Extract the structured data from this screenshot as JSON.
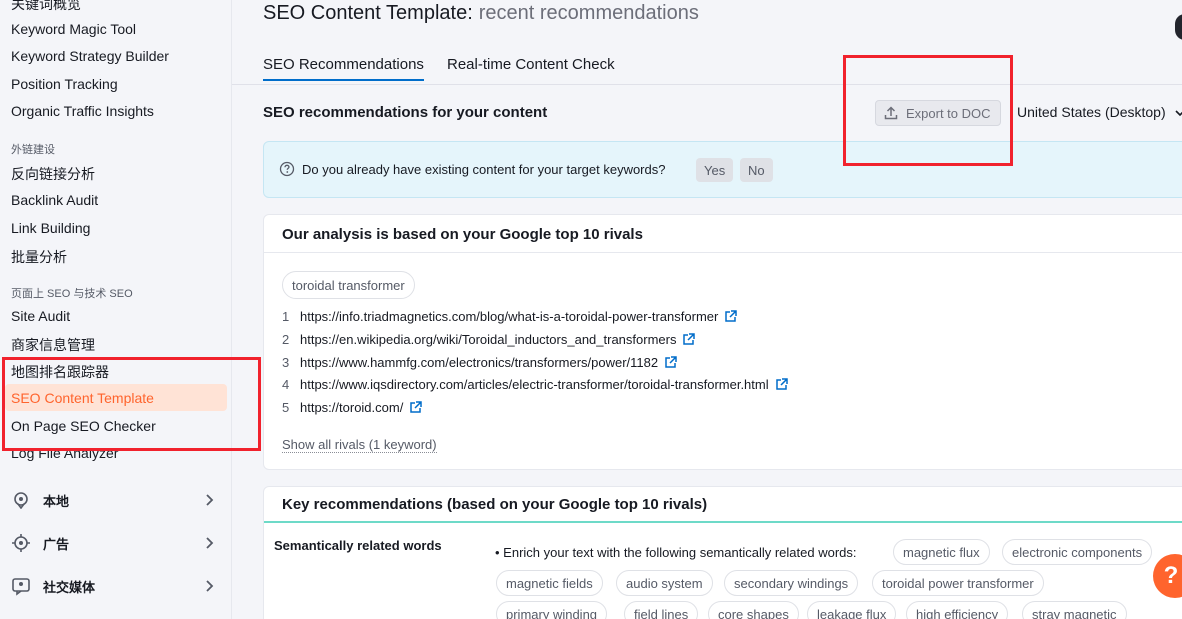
{
  "sidebar": {
    "items": [
      {
        "label": "关键词概览"
      },
      {
        "label": "Keyword Magic Tool"
      },
      {
        "label": "Keyword Strategy Builder"
      },
      {
        "label": "Position Tracking"
      },
      {
        "label": "Organic Traffic Insights"
      },
      {
        "group": "外链建设"
      },
      {
        "label": "反向链接分析"
      },
      {
        "label": "Backlink Audit"
      },
      {
        "label": "Link Building"
      },
      {
        "label": "批量分析"
      },
      {
        "group": "页面上 SEO 与技术 SEO"
      },
      {
        "label": "Site Audit"
      },
      {
        "label": "商家信息管理"
      },
      {
        "label": "地图排名跟踪器"
      },
      {
        "label": "SEO Content Template"
      },
      {
        "label": "On Page SEO Checker"
      },
      {
        "label": "Log File Analyzer"
      }
    ],
    "sections": [
      {
        "label": "本地",
        "icon": "location-pin-icon"
      },
      {
        "label": "广告",
        "icon": "target-icon"
      },
      {
        "label": "社交媒体",
        "icon": "social-media-icon"
      }
    ]
  },
  "header": {
    "title": "SEO Content Template:",
    "subtitle": "recent recommendations"
  },
  "tabs": [
    {
      "label": "SEO Recommendations"
    },
    {
      "label": "Real-time Content Check"
    }
  ],
  "recommendations": {
    "title": "SEO recommendations for your content",
    "export_label": "Export to DOC",
    "region": "United States (Desktop)"
  },
  "banner": {
    "question": "Do you already have existing content for your target keywords?",
    "yes": "Yes",
    "no": "No"
  },
  "analysis": {
    "title": "Our analysis is based on your Google top 10 rivals",
    "keyword": "toroidal transformer",
    "rivals": [
      {
        "num": "1",
        "url": "https://info.triadmagnetics.com/blog/what-is-a-toroidal-power-transformer"
      },
      {
        "num": "2",
        "url": "https://en.wikipedia.org/wiki/Toroidal_inductors_and_transformers"
      },
      {
        "num": "3",
        "url": "https://www.hammfg.com/electronics/transformers/power/1182"
      },
      {
        "num": "4",
        "url": "https://www.iqsdirectory.com/articles/electric-transformer/toroidal-transformer.html"
      },
      {
        "num": "5",
        "url": "https://toroid.com/"
      }
    ],
    "show_all": "Show all rivals (1 keyword)"
  },
  "key_recs": {
    "title": "Key recommendations (based on your Google top 10 rivals)",
    "semantic_label": "Semantically related words",
    "enrich_text": "• Enrich your text with the following semantically related words:",
    "words": [
      "magnetic flux",
      "electronic components",
      "magnetic fields",
      "audio system",
      "secondary windings",
      "toroidal power transformer",
      "primary winding",
      "field lines",
      "core shapes",
      "leakage flux",
      "high efficiency",
      "stray magnetic"
    ]
  },
  "help": {
    "label": "?"
  },
  "colors": {
    "accent": "#ff642d",
    "link": "#006dca",
    "highlight_box": "#f1222d"
  }
}
